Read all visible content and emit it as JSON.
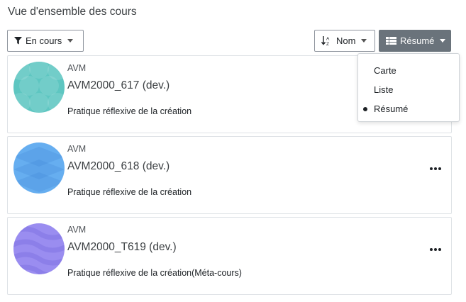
{
  "header": {
    "title": "Vue d'ensemble des cours"
  },
  "toolbar": {
    "filter_label": "En cours",
    "sort_label": "Nom",
    "view_label": "Résumé"
  },
  "view_menu": {
    "items": [
      "Carte",
      "Liste",
      "Résumé"
    ],
    "selected": "Résumé"
  },
  "courses": [
    {
      "category": "AVM",
      "name": "AVM2000_617 (dev.)",
      "summary": "Pratique réflexive de la création",
      "color": "#5ec6c1"
    },
    {
      "category": "AVM",
      "name": "AVM2000_618 (dev.)",
      "summary": "Pratique réflexive de la création",
      "color": "#66aef0"
    },
    {
      "category": "AVM",
      "name": "AVM2000_T619 (dev.)",
      "summary": "Pratique réflexive de la création(Méta-cours)",
      "color": "#9a8df0"
    }
  ],
  "icons": {
    "filter": "filter-icon",
    "sort": "sort-alpha-icon",
    "view": "grid-icon",
    "more": "ellipsis-icon",
    "caret": "caret-down-icon"
  }
}
